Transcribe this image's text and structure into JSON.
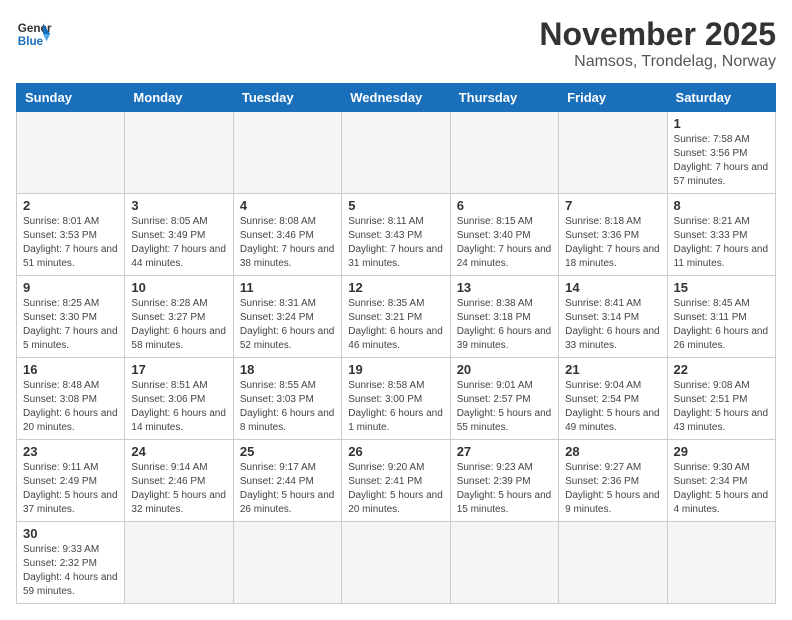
{
  "header": {
    "logo_general": "General",
    "logo_blue": "Blue",
    "month_title": "November 2025",
    "location": "Namsos, Trondelag, Norway"
  },
  "weekdays": [
    "Sunday",
    "Monday",
    "Tuesday",
    "Wednesday",
    "Thursday",
    "Friday",
    "Saturday"
  ],
  "days": [
    {
      "num": "",
      "sunrise": "",
      "sunset": "",
      "daylight": ""
    },
    {
      "num": "",
      "sunrise": "",
      "sunset": "",
      "daylight": ""
    },
    {
      "num": "",
      "sunrise": "",
      "sunset": "",
      "daylight": ""
    },
    {
      "num": "",
      "sunrise": "",
      "sunset": "",
      "daylight": ""
    },
    {
      "num": "",
      "sunrise": "",
      "sunset": "",
      "daylight": ""
    },
    {
      "num": "",
      "sunrise": "",
      "sunset": "",
      "daylight": ""
    },
    {
      "num": "1",
      "sunrise": "7:58 AM",
      "sunset": "3:56 PM",
      "daylight": "7 hours and 57 minutes."
    },
    {
      "num": "2",
      "sunrise": "8:01 AM",
      "sunset": "3:53 PM",
      "daylight": "7 hours and 51 minutes."
    },
    {
      "num": "3",
      "sunrise": "8:05 AM",
      "sunset": "3:49 PM",
      "daylight": "7 hours and 44 minutes."
    },
    {
      "num": "4",
      "sunrise": "8:08 AM",
      "sunset": "3:46 PM",
      "daylight": "7 hours and 38 minutes."
    },
    {
      "num": "5",
      "sunrise": "8:11 AM",
      "sunset": "3:43 PM",
      "daylight": "7 hours and 31 minutes."
    },
    {
      "num": "6",
      "sunrise": "8:15 AM",
      "sunset": "3:40 PM",
      "daylight": "7 hours and 24 minutes."
    },
    {
      "num": "7",
      "sunrise": "8:18 AM",
      "sunset": "3:36 PM",
      "daylight": "7 hours and 18 minutes."
    },
    {
      "num": "8",
      "sunrise": "8:21 AM",
      "sunset": "3:33 PM",
      "daylight": "7 hours and 11 minutes."
    },
    {
      "num": "9",
      "sunrise": "8:25 AM",
      "sunset": "3:30 PM",
      "daylight": "7 hours and 5 minutes."
    },
    {
      "num": "10",
      "sunrise": "8:28 AM",
      "sunset": "3:27 PM",
      "daylight": "6 hours and 58 minutes."
    },
    {
      "num": "11",
      "sunrise": "8:31 AM",
      "sunset": "3:24 PM",
      "daylight": "6 hours and 52 minutes."
    },
    {
      "num": "12",
      "sunrise": "8:35 AM",
      "sunset": "3:21 PM",
      "daylight": "6 hours and 46 minutes."
    },
    {
      "num": "13",
      "sunrise": "8:38 AM",
      "sunset": "3:18 PM",
      "daylight": "6 hours and 39 minutes."
    },
    {
      "num": "14",
      "sunrise": "8:41 AM",
      "sunset": "3:14 PM",
      "daylight": "6 hours and 33 minutes."
    },
    {
      "num": "15",
      "sunrise": "8:45 AM",
      "sunset": "3:11 PM",
      "daylight": "6 hours and 26 minutes."
    },
    {
      "num": "16",
      "sunrise": "8:48 AM",
      "sunset": "3:08 PM",
      "daylight": "6 hours and 20 minutes."
    },
    {
      "num": "17",
      "sunrise": "8:51 AM",
      "sunset": "3:06 PM",
      "daylight": "6 hours and 14 minutes."
    },
    {
      "num": "18",
      "sunrise": "8:55 AM",
      "sunset": "3:03 PM",
      "daylight": "6 hours and 8 minutes."
    },
    {
      "num": "19",
      "sunrise": "8:58 AM",
      "sunset": "3:00 PM",
      "daylight": "6 hours and 1 minute."
    },
    {
      "num": "20",
      "sunrise": "9:01 AM",
      "sunset": "2:57 PM",
      "daylight": "5 hours and 55 minutes."
    },
    {
      "num": "21",
      "sunrise": "9:04 AM",
      "sunset": "2:54 PM",
      "daylight": "5 hours and 49 minutes."
    },
    {
      "num": "22",
      "sunrise": "9:08 AM",
      "sunset": "2:51 PM",
      "daylight": "5 hours and 43 minutes."
    },
    {
      "num": "23",
      "sunrise": "9:11 AM",
      "sunset": "2:49 PM",
      "daylight": "5 hours and 37 minutes."
    },
    {
      "num": "24",
      "sunrise": "9:14 AM",
      "sunset": "2:46 PM",
      "daylight": "5 hours and 32 minutes."
    },
    {
      "num": "25",
      "sunrise": "9:17 AM",
      "sunset": "2:44 PM",
      "daylight": "5 hours and 26 minutes."
    },
    {
      "num": "26",
      "sunrise": "9:20 AM",
      "sunset": "2:41 PM",
      "daylight": "5 hours and 20 minutes."
    },
    {
      "num": "27",
      "sunrise": "9:23 AM",
      "sunset": "2:39 PM",
      "daylight": "5 hours and 15 minutes."
    },
    {
      "num": "28",
      "sunrise": "9:27 AM",
      "sunset": "2:36 PM",
      "daylight": "5 hours and 9 minutes."
    },
    {
      "num": "29",
      "sunrise": "9:30 AM",
      "sunset": "2:34 PM",
      "daylight": "5 hours and 4 minutes."
    },
    {
      "num": "30",
      "sunrise": "9:33 AM",
      "sunset": "2:32 PM",
      "daylight": "4 hours and 59 minutes."
    }
  ]
}
